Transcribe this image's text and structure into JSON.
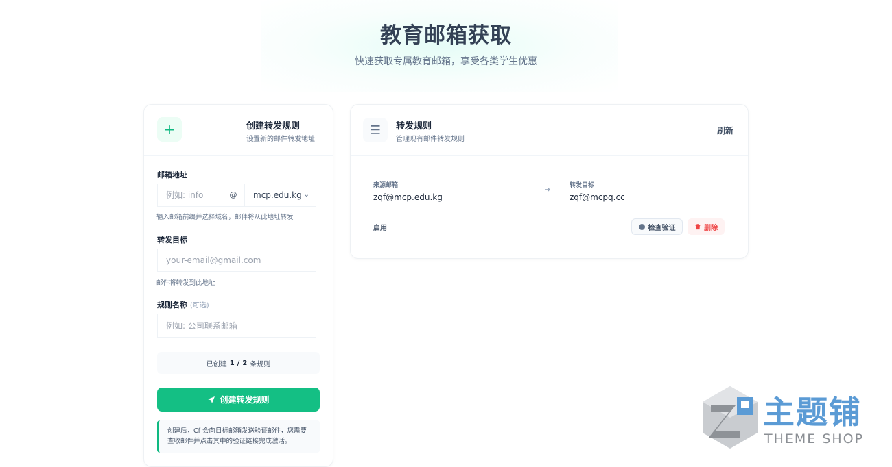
{
  "header": {
    "title": "教育邮箱获取",
    "subtitle": "快速获取专属教育邮箱，享受各类学生优惠"
  },
  "create_form": {
    "title": "创建转发规则",
    "subtitle": "设置新的邮件转发地址",
    "email_label": "邮箱地址",
    "email_placeholder": "例如: info",
    "at_symbol": "@",
    "domain_selected": "mcp.edu.kg",
    "email_hint": "输入邮箱前缀并选择域名，邮件将从此地址转发",
    "target_label": "转发目标",
    "target_placeholder": "your-email@gmail.com",
    "target_hint": "邮件将转发到此地址",
    "name_label": "规则名称",
    "name_optional": "(可选)",
    "name_placeholder": "例如: 公司联系邮箱",
    "counter_prefix": "已创建",
    "counter_used": "1",
    "counter_sep": "/",
    "counter_total": "2",
    "counter_suffix": "条规则",
    "submit_label": "创建转发规则",
    "note": "创建后，Cf 会向目标邮箱发送验证邮件，您需要查收邮件并点击其中的验证链接完成激活。"
  },
  "rules_panel": {
    "title": "转发规则",
    "subtitle": "管理现有邮件转发规则",
    "refresh_label": "刷新",
    "rules": [
      {
        "source_label": "来源邮箱",
        "source": "zqf@mcp.edu.kg",
        "target_label": "转发目标",
        "target": "zqf@mcpq.cc",
        "status": "启用",
        "check_label": "检查验证",
        "delete_label": "删除"
      }
    ]
  },
  "watermark": {
    "brand_cn": "主题铺",
    "brand_en": "THEME SHOP"
  },
  "colors": {
    "primary": "#14bf84",
    "danger": "#ef4444",
    "title": "#334155",
    "watermark_blue": "#5b9bd5"
  },
  "icons": [
    "plus-icon",
    "menu-icon",
    "chevron-down-icon",
    "send-icon",
    "arrow-right-icon",
    "dot-icon",
    "trash-icon",
    "logo-icon"
  ]
}
